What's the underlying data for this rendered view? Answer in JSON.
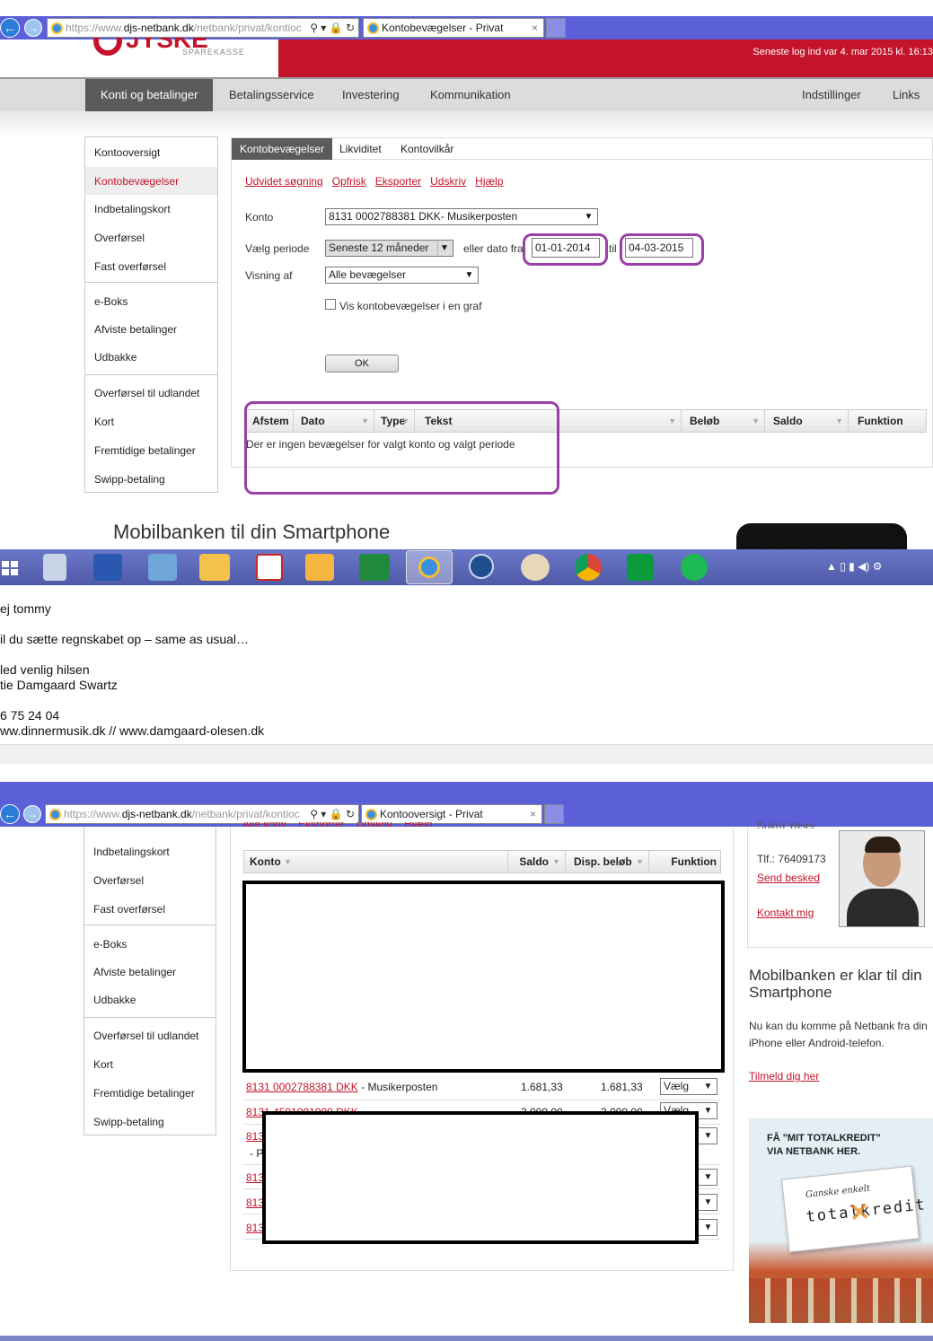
{
  "screen1": {
    "browser": {
      "url_prefix": "https://www.",
      "url_host": "djs-netbank.dk",
      "url_path": "/netbank/privat/kontioc",
      "url_controls": "⚲ ▾ 🔒 ↻",
      "tab_title": "Kontobevægelser - Privat",
      "tab_close": "×"
    },
    "logo_text": "SPAREKASSE",
    "logo_big": "JYSKE",
    "last_login": "Seneste log ind var 4. mar 2015 kl. 16:13",
    "mainnav": {
      "items": [
        "Konti og betalinger",
        "Betalingsservice",
        "Investering",
        "Kommunikation"
      ],
      "right_items": [
        "Indstillinger",
        "Links"
      ]
    },
    "leftnav": {
      "group1": [
        "Kontooversigt",
        "Kontobevægelser",
        "Indbetalingskort",
        "Overførsel",
        "Fast overførsel"
      ],
      "group2": [
        "e-Boks",
        "Afviste betalinger",
        "Udbakke"
      ],
      "group3": [
        "Overførsel til udlandet",
        "Kort",
        "Fremtidige betalinger",
        "Swipp-betaling"
      ]
    },
    "subtabs": [
      "Kontobevægelser",
      "Likviditet",
      "Kontovilkår"
    ],
    "action_links": [
      "Udvidet søgning",
      "Opfrisk",
      "Eksporter",
      "Udskriv",
      "Hjælp"
    ],
    "form": {
      "konto_label": "Konto",
      "konto_value": "8131 0002788381 DKK- Musikerposten",
      "periode_label": "Vælg periode",
      "periode_value": "Seneste 12 måneder",
      "eller_dato_fra": "eller dato fra",
      "date_from": "01-01-2014",
      "til": "til",
      "date_to": "04-03-2015",
      "visning_label": "Visning af",
      "visning_value": "Alle bevægelser",
      "graph_checkbox_label": "Vis kontobevægelser i en graf",
      "ok_button": "OK",
      "dropdown_arrow": "▼"
    },
    "table": {
      "headers": [
        "Afstem",
        "Dato",
        "Type",
        "Tekst",
        "Beløb",
        "Saldo",
        "Funktion"
      ],
      "sort_arrow": "▼",
      "empty_message": "Der er ingen bevægelser for valgt konto og valgt periode"
    },
    "promo_title": "Mobilbanken til din Smartphone"
  },
  "taskbar": {
    "icons": [
      "windows-icon",
      "calculator-icon",
      "word-icon",
      "remote-desktop-icon",
      "file-explorer-icon",
      "acrobat-icon",
      "outlook-icon",
      "excel-icon",
      "internet-explorer-icon",
      "su-icon",
      "paint-icon",
      "chrome-icon",
      "store-icon",
      "spotify-icon"
    ],
    "tray": "▲ ▯ ▮ ◀) ⚙"
  },
  "email": {
    "greeting": "ej tommy",
    "body": "il du sætte regnskabet op – same as usual…",
    "closing": "led venlig hilsen",
    "name": "tie Damgaard Swartz",
    "phone": "6 75 24 04",
    "websites": "ww.dinnermusik.dk // www.damgaard-olesen.dk"
  },
  "screen2": {
    "browser": {
      "url_prefix": "https://www.",
      "url_host": "djs-netbank.dk",
      "url_path": "/netbank/privat/kontioc",
      "url_controls": "⚲ ▾ 🔒 ↻",
      "tab_title": "Kontooversigt - Privat",
      "tab_close": "×"
    },
    "top_links": [
      "Alle konti",
      "Eksporter",
      "Udskriv",
      "Hjælp"
    ],
    "leftnav": {
      "group1": [
        "Indbetalingskort",
        "Overførsel",
        "Fast overførsel"
      ],
      "group2": [
        "e-Boks",
        "Afviste betalinger",
        "Udbakke"
      ],
      "group3": [
        "Overførsel til udlandet",
        "Kort",
        "Fremtidige betalinger",
        "Swipp-betaling"
      ]
    },
    "table": {
      "headers": [
        "Konto",
        "Saldo",
        "Disp. beløb",
        "Funktion"
      ],
      "sort_arrow": "▼",
      "row1": {
        "account_link": "8131 0002788381 DKK",
        "account_name": " - Musikerposten",
        "saldo": "1.681,33",
        "disp": "1.681,33",
        "function": "Vælg"
      },
      "partial_rows": [
        "813",
        "813",
        "813",
        "813",
        "813"
      ],
      "partial_row2_link": "8131 4501001000 DKK",
      "partial_row2_values": [
        "3.000,00",
        "3.000,00"
      ],
      "partial_dash": "- P",
      "partial_function": "Vælg"
    },
    "advisor": {
      "name_partial": "Sukru Yaser",
      "phone": "Tlf.: 76409173",
      "send_link": "Send besked",
      "contact_link": "Kontakt mig"
    },
    "promo": {
      "title": "Mobilbanken er klar til din Smartphone",
      "body": "Nu kan du komme på Netbank fra din iPhone eller Android-telefon.",
      "link": "Tilmeld dig her"
    },
    "ad": {
      "headline_line1": "FÅ \"MIT TOTALKREDIT\"",
      "headline_line2": "VIA NETBANK HER.",
      "card_small": "Ganske enkelt",
      "card_brand": "totalkredit"
    }
  },
  "colors": {
    "brand_red": "#c4142b",
    "browser_chrome": "#5b5fd8",
    "highlight_purple": "#9b3fa8",
    "nav_active": "#5b5b5b"
  }
}
